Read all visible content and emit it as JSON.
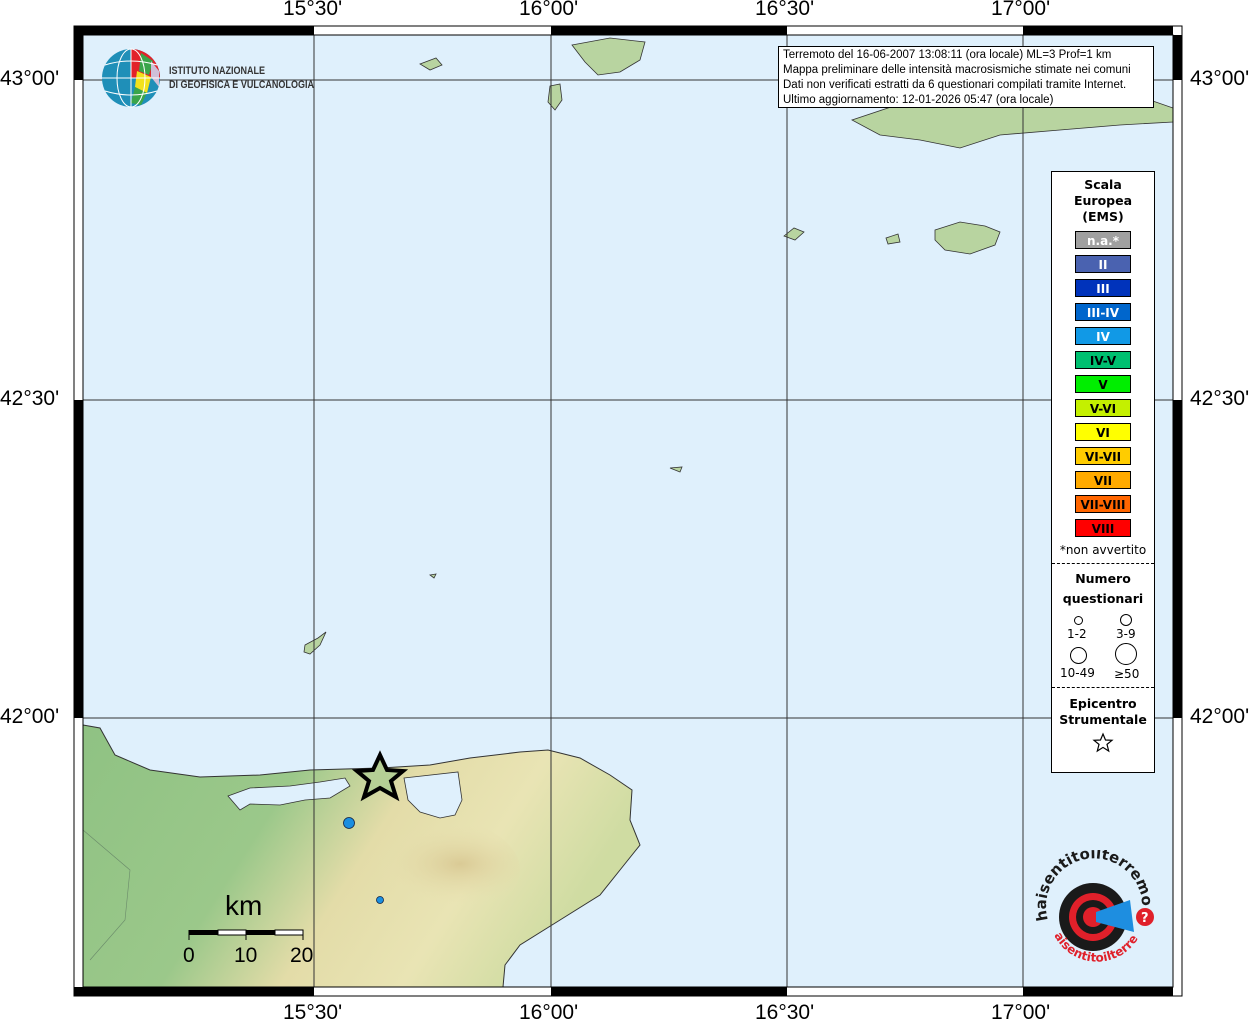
{
  "map": {
    "top_ticks": [
      "15°30'",
      "16°00'",
      "16°30'",
      "17°00'"
    ],
    "bottom_ticks": [
      "15°30'",
      "16°00'",
      "16°30'",
      "17°00'"
    ],
    "left_ticks": [
      "43°00'",
      "42°30'",
      "42°00'"
    ],
    "right_ticks": [
      "43°00'",
      "42°30'",
      "42°00'"
    ],
    "colors": {
      "sea": "#dff0fc",
      "land_low": "#8dbf7f",
      "land_high": "#e8e2b0",
      "point": "#1a8ee0"
    }
  },
  "info": {
    "lines": [
      "Terremoto del 16-06-2007 13:08:11 (ora locale) ML=3 Prof=1 km",
      "Mappa preliminare delle intensità macrosismiche stimate nei comuni",
      "Dati non verificati estratti da 6 questionari compilati tramite Internet.",
      "Ultimo aggiornamento: 12-01-2026 05:47 (ora locale)"
    ]
  },
  "ingv_logo": {
    "line1": "ISTITUTO NAZIONALE",
    "line2": "DI GEOFISICA E VULCANOLOGIA"
  },
  "legend": {
    "title": [
      "Scala",
      "Europea",
      "(EMS)"
    ],
    "classes": [
      {
        "label": "n.a.*",
        "color": "#a0a0a0",
        "text_color": "#ffffff"
      },
      {
        "label": "II",
        "color": "#4a62b0",
        "text_color": "#ffffff"
      },
      {
        "label": "III",
        "color": "#0033bb",
        "text_color": "#ffffff"
      },
      {
        "label": "III-IV",
        "color": "#0066cc",
        "text_color": "#ffffff"
      },
      {
        "label": "IV",
        "color": "#1199e6",
        "text_color": "#ffffff"
      },
      {
        "label": "IV-V",
        "color": "#00c070",
        "text_color": "#000000"
      },
      {
        "label": "V",
        "color": "#00ee00",
        "text_color": "#000000"
      },
      {
        "label": "V-VI",
        "color": "#c4f000",
        "text_color": "#000000"
      },
      {
        "label": "VI",
        "color": "#ffff00",
        "text_color": "#000000"
      },
      {
        "label": "VI-VII",
        "color": "#ffcc00",
        "text_color": "#000000"
      },
      {
        "label": "VII",
        "color": "#ffaa00",
        "text_color": "#000000"
      },
      {
        "label": "VII-VIII",
        "color": "#ff6600",
        "text_color": "#000000"
      },
      {
        "label": "VIII",
        "color": "#ff0000",
        "text_color": "#000000"
      }
    ],
    "footnote": "*non avvertito",
    "count_title": [
      "Numero",
      "questionari"
    ],
    "count_classes": [
      "1-2",
      "3-9",
      "10-49",
      "≥50"
    ],
    "epicenter_title": [
      "Epicentro",
      "Strumentale"
    ]
  },
  "scalebar": {
    "unit": "km",
    "labels": [
      "0",
      "10",
      "20"
    ]
  },
  "hsit_logo": {
    "text": "www.haisentitoilterremoto.it"
  }
}
